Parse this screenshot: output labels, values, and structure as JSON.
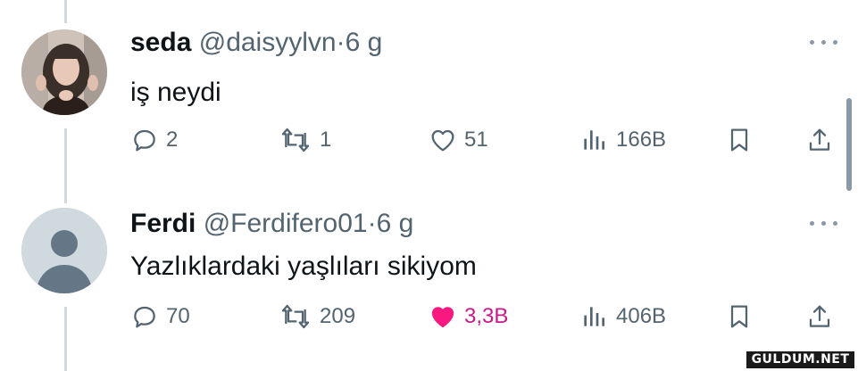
{
  "tweets": [
    {
      "name": "seda",
      "handle": "@daisyylvn",
      "separator": "·",
      "time": "6 g",
      "text": "iş neydi",
      "replies": "2",
      "retweets": "1",
      "likes": "51",
      "views": "166B",
      "liked": false,
      "avatar_type": "photo"
    },
    {
      "name": "Ferdi",
      "handle": "@Ferdifero01",
      "separator": "·",
      "time": "6 g",
      "text": "Yazlıklardaki yaşlıları sikiyom",
      "replies": "70",
      "retweets": "209",
      "likes": "3,3B",
      "views": "406B",
      "liked": true,
      "avatar_type": "default"
    }
  ],
  "colors": {
    "text": "#0f1419",
    "secondary": "#536471",
    "like_active": "#f91880",
    "thread_line": "#cfd9de"
  },
  "icons": [
    "reply-icon",
    "retweet-icon",
    "like-icon",
    "views-icon",
    "bookmark-icon",
    "share-icon",
    "more-icon"
  ],
  "watermark": "GULDUM.NET"
}
